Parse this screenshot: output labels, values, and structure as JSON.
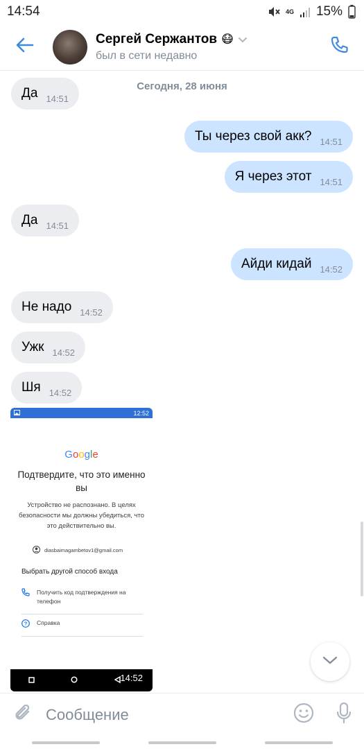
{
  "status_bar": {
    "time": "14:54",
    "network": "4G",
    "battery": "15%"
  },
  "header": {
    "contact_name": "Сергей Сержантов",
    "contact_emoji": "😷",
    "contact_status": "был в сети недавно",
    "icons": {
      "back": "arrow-left-icon",
      "call": "phone-icon",
      "chevron": "chevron-down-icon"
    }
  },
  "date_label": "Сегодня, 28 июня",
  "messages": [
    {
      "direction": "in",
      "text": "Да",
      "time": "14:51"
    },
    {
      "direction": "out",
      "text": "Ты через свой акк?",
      "time": "14:51"
    },
    {
      "direction": "out",
      "text": "Я через этот",
      "time": "14:51"
    },
    {
      "direction": "in",
      "text": "Да",
      "time": "14:51"
    },
    {
      "direction": "out",
      "text": "Айди кидай",
      "time": "14:52"
    },
    {
      "direction": "in",
      "text": "Не надо",
      "time": "14:52"
    },
    {
      "direction": "in",
      "text": "Ужк",
      "time": "14:52"
    },
    {
      "direction": "in",
      "text": "Шя",
      "time": "14:52"
    }
  ],
  "screenshot": {
    "status_time": "12:52",
    "logo": [
      "G",
      "o",
      "o",
      "g",
      "l",
      "e"
    ],
    "logo_colors": [
      "#4285f4",
      "#ea4335",
      "#fbbc05",
      "#4285f4",
      "#34a853",
      "#ea4335"
    ],
    "title": "Подтвердите, что это именно вы",
    "description": "Устройство не распознано. В целях безопасности мы должны убедиться, что это действительно вы.",
    "email": "diasbaimagambetov1@gmail.com",
    "other_method": "Выбрать другой способ входа",
    "option_code": "Получить код подтверждения на телефон",
    "option_help": "Справка",
    "time": "14:52"
  },
  "composer": {
    "placeholder": "Сообщение"
  },
  "colors": {
    "accent": "#3f8ae0",
    "bubble_in": "#ebedf0",
    "bubble_out": "#cce4ff",
    "meta": "#818c99"
  }
}
